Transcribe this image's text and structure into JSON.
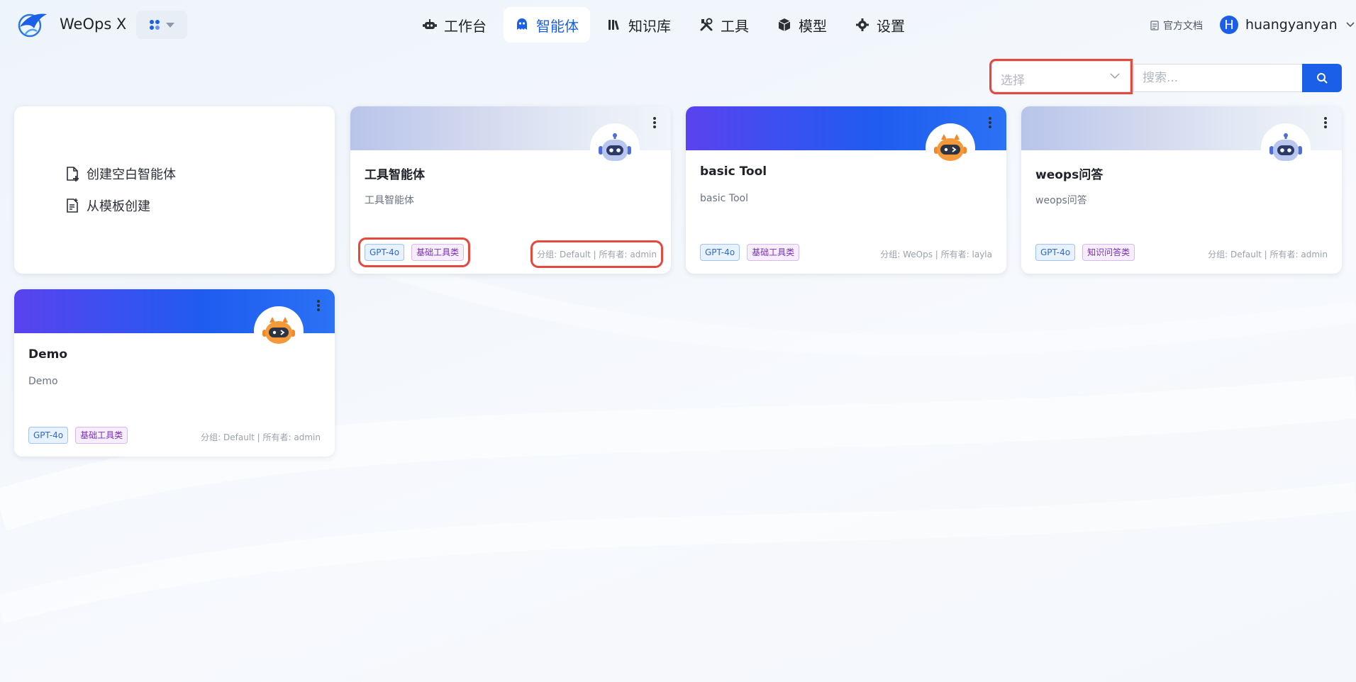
{
  "header": {
    "brand": "WeOps X",
    "nav": [
      {
        "label": "工作台",
        "icon": "robot-icon",
        "active": false
      },
      {
        "label": "智能体",
        "icon": "bot-head-icon",
        "active": true
      },
      {
        "label": "知识库",
        "icon": "books-icon",
        "active": false
      },
      {
        "label": "工具",
        "icon": "tools-icon",
        "active": false
      },
      {
        "label": "模型",
        "icon": "cube-icon",
        "active": false
      },
      {
        "label": "设置",
        "icon": "gear-icon",
        "active": false
      }
    ],
    "docs_label": "官方文档",
    "user_initial": "H",
    "user_name": "huangyanyan"
  },
  "toolbar": {
    "select_placeholder": "选择",
    "search_placeholder": "搜索..."
  },
  "create_card": {
    "blank_label": "创建空白智能体",
    "template_label": "从模板创建"
  },
  "cards": [
    {
      "title": "工具智能体",
      "desc": "工具智能体",
      "model_tag": "GPT-4o",
      "category_tag": "基础工具类",
      "meta": "分组: Default | 所有者: admin",
      "banner": "light",
      "avatar": "robot-blue"
    },
    {
      "title": "basic Tool",
      "desc": "basic Tool",
      "model_tag": "GPT-4o",
      "category_tag": "基础工具类",
      "meta": "分组: WeOps | 所有者: layla",
      "banner": "dark",
      "avatar": "robot-orange"
    },
    {
      "title": "weops问答",
      "desc": "weops问答",
      "model_tag": "GPT-4o",
      "category_tag": "知识问答类",
      "meta": "分组: Default | 所有者: admin",
      "banner": "light",
      "avatar": "robot-blue"
    },
    {
      "title": "Demo",
      "desc": "Demo",
      "model_tag": "GPT-4o",
      "category_tag": "基础工具类",
      "meta": "分组: Default | 所有者: admin",
      "banner": "dark",
      "avatar": "robot-orange"
    }
  ],
  "colors": {
    "accent": "#1b5fe8",
    "highlight": "#e5483d"
  }
}
